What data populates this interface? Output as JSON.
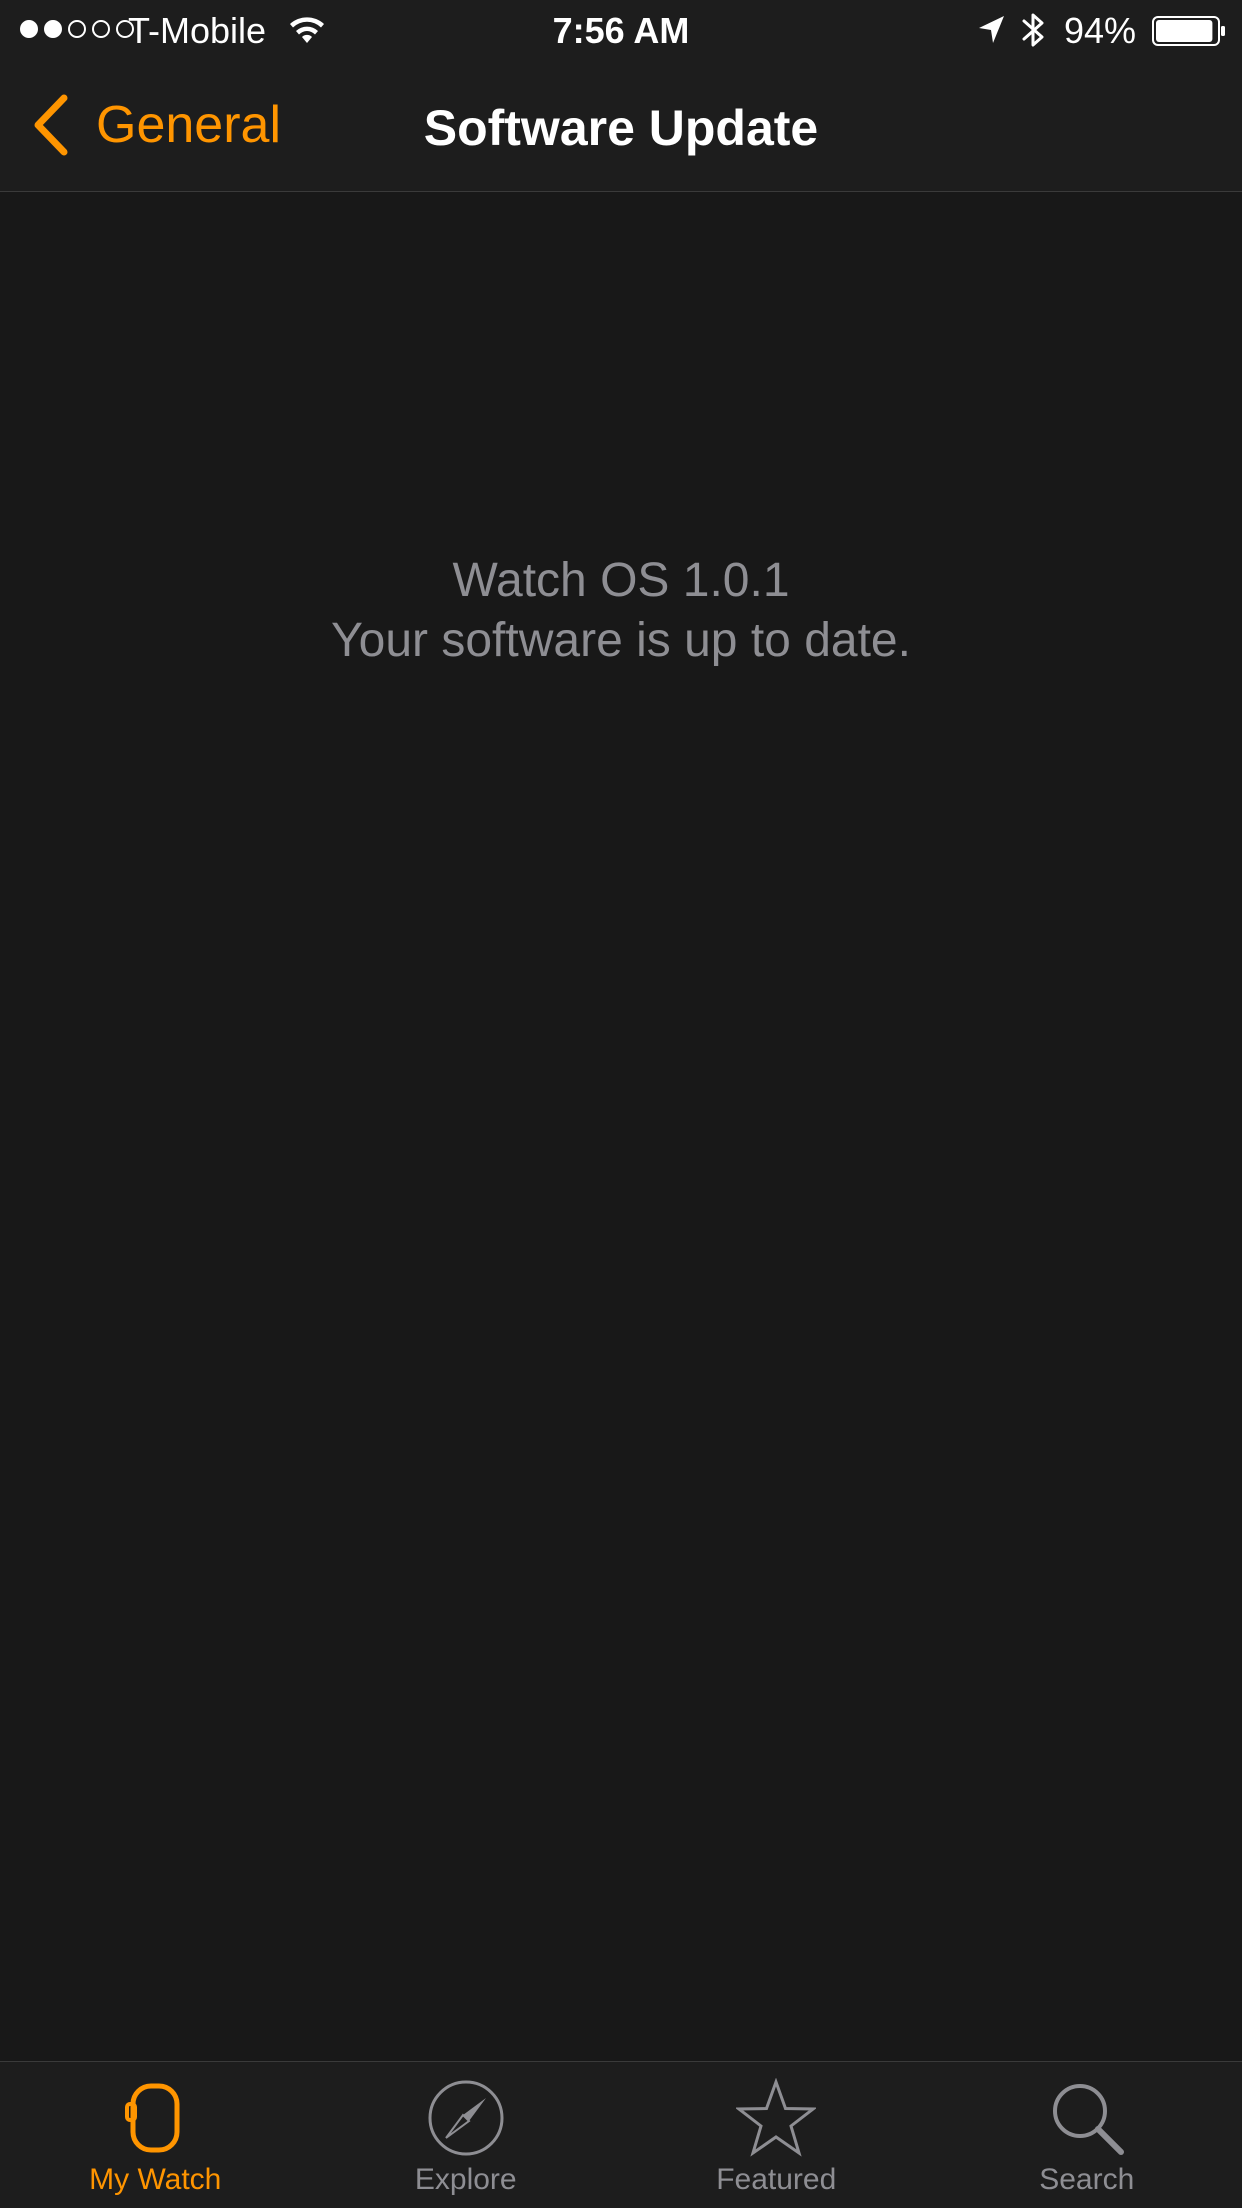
{
  "status_bar": {
    "signal_bars_filled": 2,
    "signal_bars_total": 5,
    "carrier": "T-Mobile",
    "time": "7:56 AM",
    "battery_percent_label": "94%",
    "battery_level": 0.94,
    "icons": [
      "wifi-icon",
      "location-arrow-icon",
      "bluetooth-icon",
      "battery-icon"
    ]
  },
  "nav": {
    "back_label": "General",
    "title": "Software Update"
  },
  "main": {
    "version": "Watch OS 1.0.1",
    "status": "Your software is up to date."
  },
  "tabs": [
    {
      "label": "My Watch",
      "icon": "watch-icon",
      "active": true
    },
    {
      "label": "Explore",
      "icon": "compass-icon",
      "active": false
    },
    {
      "label": "Featured",
      "icon": "star-icon",
      "active": false
    },
    {
      "label": "Search",
      "icon": "search-icon",
      "active": false
    }
  ],
  "colors": {
    "accent": "#ff9500",
    "background": "#181818",
    "bar_background": "#1d1d1d",
    "secondary_text": "#8e8e93",
    "text": "#ffffff"
  }
}
